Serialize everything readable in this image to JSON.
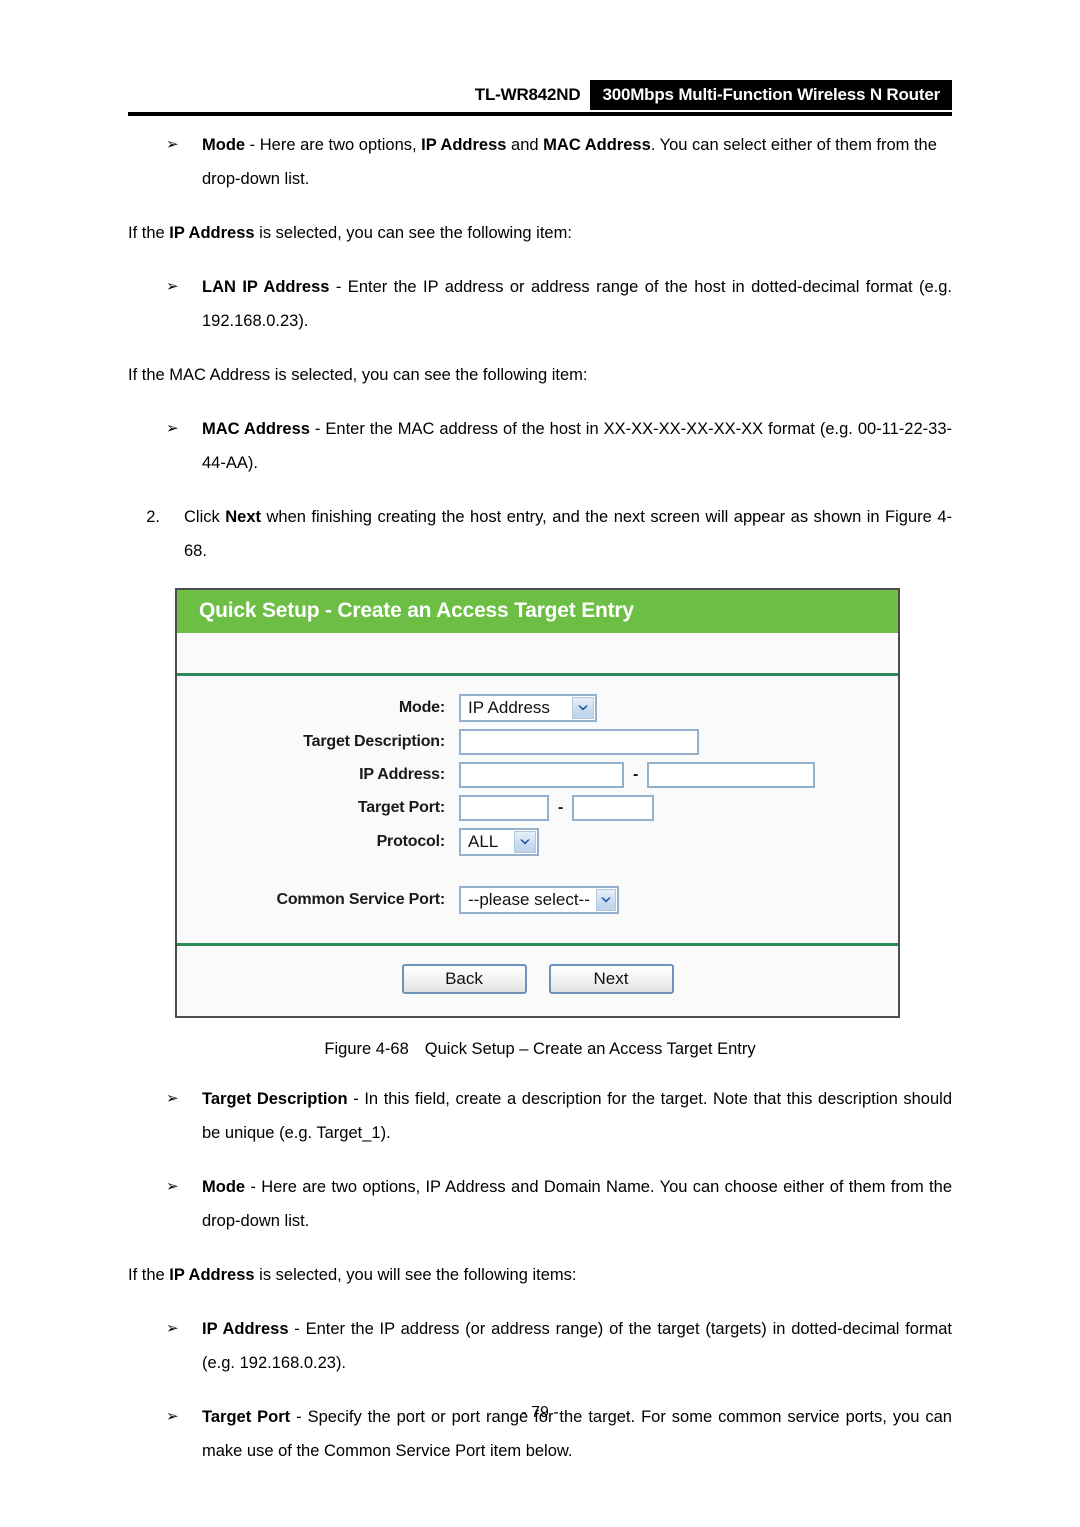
{
  "header": {
    "model": "TL-WR842ND",
    "product": "300Mbps Multi-Function Wireless N Router"
  },
  "body": {
    "bullet_marker": "➢",
    "mode_bullet": {
      "term": "Mode",
      "text_1": " - Here are two options, ",
      "bold_1": "IP Address",
      "text_2": " and ",
      "bold_2": "MAC Address",
      "text_3": ". You can select either of them from the drop-down list."
    },
    "ip_selected_note": {
      "lead": "If the ",
      "bold": "IP Address",
      "tail": " is selected, you can see the following item:"
    },
    "lan_ip_bullet": {
      "term": "LAN IP Address",
      "text": " - Enter the IP address or address range of the host in dotted-decimal format (e.g. 192.168.0.23)."
    },
    "mac_selected_note": "If the MAC Address is selected, you can see the following item:",
    "mac_bullet": {
      "term": "MAC Address",
      "text": " - Enter the MAC address of the host in XX-XX-XX-XX-XX-XX format (e.g. 00-11-22-33-44-AA)."
    },
    "step_two": {
      "number": "2.",
      "lead": "Click ",
      "bold": "Next",
      "tail": " when finishing creating the host entry, and the next screen will appear as shown in Figure 4-68."
    },
    "target_description_bullet": {
      "term": "Target Description",
      "text": " - In this field, create a description for the target. Note that this description should be unique (e.g. Target_1)."
    },
    "mode_bullet_2": {
      "term": "Mode",
      "text": " - Here are two options, IP Address and Domain Name. You can choose either of them from the drop-down list."
    },
    "ip_selected_note_2": {
      "lead": "If the ",
      "bold": "IP Address",
      "tail": " is selected, you will see the following items:"
    },
    "ip_address_bullet": {
      "term": "IP Address",
      "text": " - Enter the IP address (or address range) of the target (targets) in dotted-decimal format (e.g. 192.168.0.23)."
    },
    "target_port_bullet": {
      "term": "Target Port",
      "text": " - Specify the port or port range for the target. For some common service ports, you can make use of the Common Service Port item below."
    }
  },
  "figure": {
    "caption_number": "Figure 4-68",
    "caption_text": "Quick Setup – Create an Access Target Entry",
    "panel": {
      "title": "Quick Setup - Create an Access Target Entry",
      "accent_green": "#6cbe45",
      "separator_green": "#2e8b57",
      "input_border": "#93b0cc",
      "labels": {
        "mode": "Mode:",
        "target_description": "Target Description:",
        "ip_address": "IP Address:",
        "target_port": "Target Port:",
        "protocol": "Protocol:",
        "common_service_port": "Common Service Port:"
      },
      "values": {
        "mode": "IP Address",
        "target_description": "",
        "ip_address_start": "",
        "ip_address_end": "",
        "target_port_start": "",
        "target_port_end": "",
        "protocol": "ALL",
        "common_service_port": "--please select--"
      },
      "range_separator": "-",
      "buttons": {
        "back": "Back",
        "next": "Next"
      }
    }
  },
  "footer": {
    "page_number": "- 79 -"
  }
}
